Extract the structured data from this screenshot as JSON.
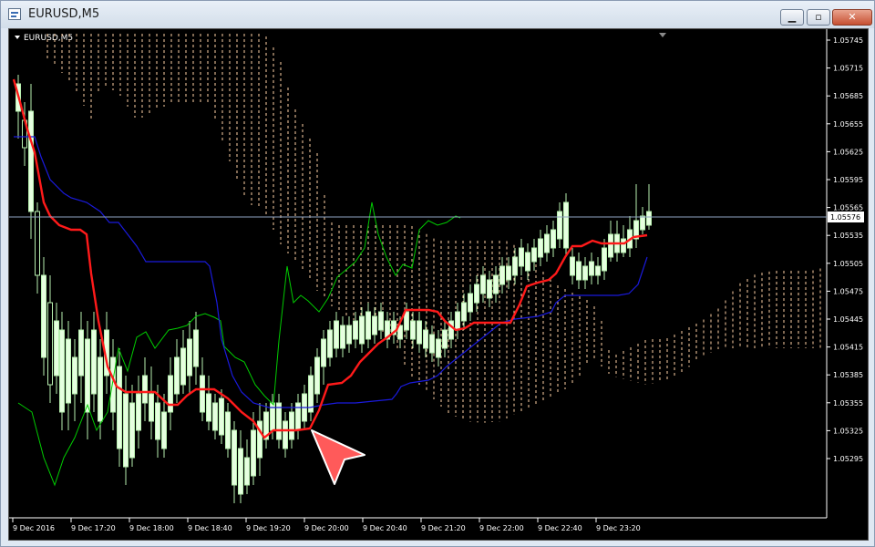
{
  "window": {
    "title": "EURUSD,M5",
    "minimize": "▁",
    "maximize": "▫",
    "close": "✕"
  },
  "chart": {
    "symbol_label": "EURUSD,M5",
    "price_labels": [
      "1.05745",
      "1.05715",
      "1.05685",
      "1.05655",
      "1.05625",
      "1.05595",
      "1.05565",
      "1.05535",
      "1.05505",
      "1.05475",
      "1.05445",
      "1.05415",
      "1.05385",
      "1.05355",
      "1.05325",
      "1.05295"
    ],
    "current_price": "1.05576",
    "time_labels": [
      "9 Dec 2016",
      "9 Dec 17:20",
      "9 Dec 18:00",
      "9 Dec 18:40",
      "9 Dec 19:20",
      "9 Dec 20:00",
      "9 Dec 20:40",
      "9 Dec 21:20",
      "9 Dec 22:00",
      "9 Dec 22:40",
      "9 Dec 23:20"
    ],
    "colors": {
      "background": "#000000",
      "bull": "#ccffcc",
      "bear": "#ccffcc",
      "tenkan": "#ff0000",
      "kijun": "#0000ff",
      "chikou": "#00cc00",
      "kumo": "#ffcc99",
      "grid_text": "#ffffff",
      "cursor": "#ff5a5a"
    }
  }
}
